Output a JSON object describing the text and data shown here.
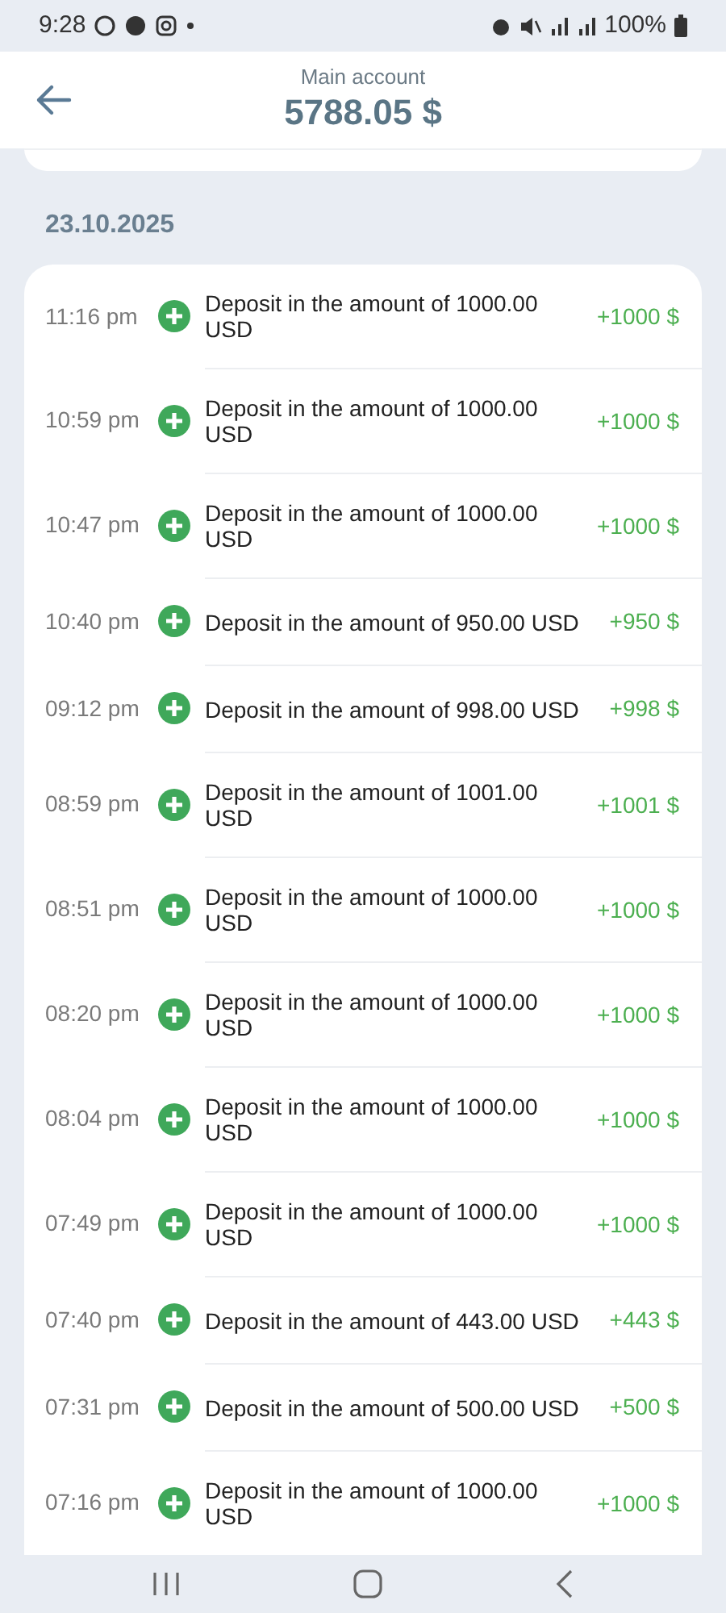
{
  "status_bar": {
    "time": "9:28",
    "battery": "100%"
  },
  "header": {
    "subtitle": "Main account",
    "balance": "5788.05 $"
  },
  "date": "23.10.2025",
  "transactions": [
    {
      "time": "11:16 pm",
      "description": "Deposit in the amount of 1000.00 USD",
      "amount": "+1000 $"
    },
    {
      "time": "10:59 pm",
      "description": "Deposit in the amount of 1000.00 USD",
      "amount": "+1000 $"
    },
    {
      "time": "10:47 pm",
      "description": "Deposit in the amount of 1000.00 USD",
      "amount": "+1000 $"
    },
    {
      "time": "10:40 pm",
      "description": "Deposit in the amount of 950.00 USD",
      "amount": "+950 $"
    },
    {
      "time": "09:12 pm",
      "description": "Deposit in the amount of 998.00 USD",
      "amount": "+998 $"
    },
    {
      "time": "08:59 pm",
      "description": "Deposit in the amount of 1001.00 USD",
      "amount": "+1001 $"
    },
    {
      "time": "08:51 pm",
      "description": "Deposit in the amount of 1000.00 USD",
      "amount": "+1000 $"
    },
    {
      "time": "08:20 pm",
      "description": "Deposit in the amount of 1000.00 USD",
      "amount": "+1000 $"
    },
    {
      "time": "08:04 pm",
      "description": "Deposit in the amount of 1000.00 USD",
      "amount": "+1000 $"
    },
    {
      "time": "07:49 pm",
      "description": "Deposit in the amount of 1000.00 USD",
      "amount": "+1000 $"
    },
    {
      "time": "07:40 pm",
      "description": "Deposit in the amount of 443.00 USD",
      "amount": "+443 $"
    },
    {
      "time": "07:31 pm",
      "description": "Deposit in the amount of 500.00 USD",
      "amount": "+500 $"
    },
    {
      "time": "07:16 pm",
      "description": "Deposit in the amount of 1000.00 USD",
      "amount": "+1000 $"
    }
  ]
}
